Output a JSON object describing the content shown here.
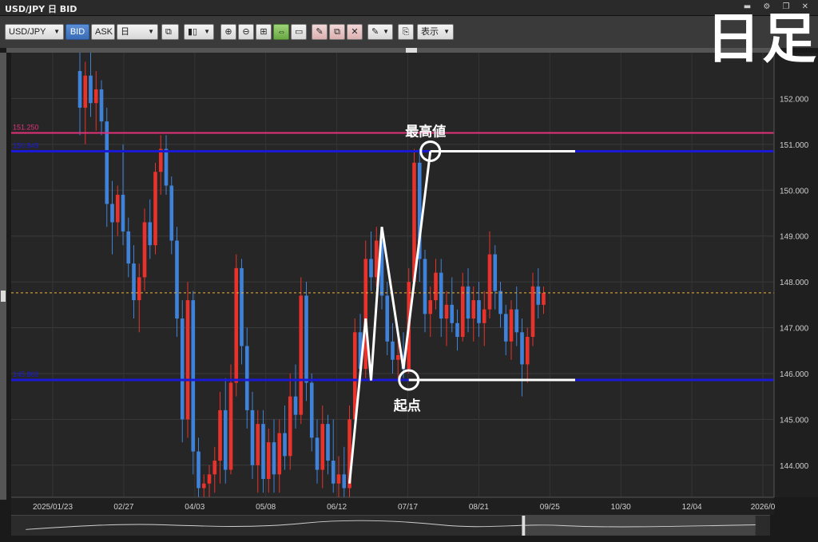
{
  "window": {
    "title": "USD/JPY 日 BID"
  },
  "page_heading": "日足",
  "toolbar": {
    "symbol": "USD/JPY",
    "bid_label": "BID",
    "ask_label": "ASK",
    "period": "日",
    "display_label": "表示"
  },
  "colors": {
    "background": "#262626",
    "up_candle": "#e8322b",
    "down_candle": "#3f82d9",
    "blue_line": "#1a1ad6",
    "pink_line": "#e0317b",
    "current_price": "#f0b23a"
  },
  "chart_data": {
    "type": "candlestick",
    "ylim": [
      143.3,
      153.0
    ],
    "y_ticks": [
      "152.000",
      "151.000",
      "150.000",
      "149.000",
      "148.000",
      "147.000",
      "146.000",
      "145.000",
      "144.000"
    ],
    "y_tick_values": [
      152,
      151,
      150,
      149,
      148,
      147,
      146,
      145,
      144
    ],
    "x_ticks": [
      "2025/01/23",
      "02/27",
      "04/03",
      "05/08",
      "06/12",
      "07/17",
      "08/21",
      "09/25",
      "10/30",
      "12/04",
      "2026/0"
    ],
    "horizontal_lines": [
      {
        "value": 151.25,
        "label": "151.250",
        "color": "pink"
      },
      {
        "value": 150.85,
        "label": "150.849",
        "color": "blue"
      },
      {
        "value": 145.86,
        "label": "145.860",
        "color": "blue"
      }
    ],
    "current_price": {
      "value": 147.761,
      "label": "147.761"
    },
    "annotations": [
      {
        "text": "最高値",
        "x_index": 65,
        "y": 150.85
      },
      {
        "text": "起点",
        "x_index": 61,
        "y": 145.86
      }
    ],
    "zigzag": [
      {
        "x_index": 50,
        "y": 143.6
      },
      {
        "x_index": 53,
        "y": 147.2
      },
      {
        "x_index": 54,
        "y": 145.85
      },
      {
        "x_index": 56,
        "y": 149.2
      },
      {
        "x_index": 60,
        "y": 146.1
      },
      {
        "x_index": 65,
        "y": 150.85
      }
    ],
    "candles": [
      [
        152.6,
        153.0,
        151.2,
        151.8
      ],
      [
        151.8,
        152.8,
        151.0,
        152.5
      ],
      [
        152.5,
        153.0,
        151.6,
        151.9
      ],
      [
        151.9,
        152.6,
        151.3,
        152.2
      ],
      [
        152.2,
        152.4,
        151.2,
        151.5
      ],
      [
        151.5,
        151.8,
        149.2,
        149.7
      ],
      [
        149.7,
        150.2,
        148.6,
        149.3
      ],
      [
        149.3,
        150.1,
        149.0,
        149.9
      ],
      [
        149.9,
        151.0,
        148.8,
        149.1
      ],
      [
        149.1,
        149.4,
        148.1,
        148.4
      ],
      [
        148.4,
        148.8,
        147.2,
        147.6
      ],
      [
        147.6,
        148.4,
        146.9,
        148.1
      ],
      [
        148.1,
        149.6,
        147.8,
        149.3
      ],
      [
        149.3,
        149.8,
        148.5,
        148.8
      ],
      [
        148.8,
        150.6,
        148.6,
        150.4
      ],
      [
        150.4,
        151.2,
        149.9,
        150.9
      ],
      [
        150.9,
        151.2,
        149.9,
        150.1
      ],
      [
        150.1,
        150.3,
        148.6,
        148.9
      ],
      [
        148.9,
        149.2,
        146.8,
        147.2
      ],
      [
        147.2,
        147.6,
        144.5,
        145.0
      ],
      [
        145.0,
        148.0,
        144.6,
        147.6
      ],
      [
        147.6,
        147.8,
        143.8,
        144.3
      ],
      [
        144.3,
        144.6,
        143.3,
        143.5
      ],
      [
        143.5,
        143.8,
        143.3,
        143.6
      ],
      [
        143.6,
        144.0,
        143.3,
        143.8
      ],
      [
        143.8,
        144.4,
        143.4,
        144.1
      ],
      [
        144.1,
        145.6,
        143.6,
        145.2
      ],
      [
        145.2,
        145.9,
        143.6,
        143.9
      ],
      [
        143.9,
        146.2,
        143.8,
        145.8
      ],
      [
        145.8,
        148.6,
        145.5,
        148.3
      ],
      [
        148.3,
        148.5,
        146.2,
        146.6
      ],
      [
        146.6,
        147.0,
        144.8,
        145.2
      ],
      [
        145.2,
        145.6,
        143.7,
        144.0
      ],
      [
        144.0,
        145.2,
        143.4,
        144.9
      ],
      [
        144.9,
        145.2,
        143.4,
        143.7
      ],
      [
        143.7,
        144.8,
        143.4,
        144.5
      ],
      [
        144.5,
        145.0,
        143.4,
        143.8
      ],
      [
        143.8,
        145.0,
        143.4,
        144.7
      ],
      [
        144.7,
        145.3,
        143.9,
        144.2
      ],
      [
        144.2,
        146.0,
        143.9,
        145.5
      ],
      [
        145.5,
        146.2,
        144.8,
        145.1
      ],
      [
        145.1,
        148.1,
        144.9,
        147.7
      ],
      [
        147.7,
        148.0,
        145.4,
        145.8
      ],
      [
        145.8,
        146.0,
        144.3,
        144.6
      ],
      [
        144.6,
        145.0,
        143.6,
        143.9
      ],
      [
        143.9,
        145.3,
        143.5,
        144.9
      ],
      [
        144.9,
        145.1,
        143.8,
        144.1
      ],
      [
        144.1,
        145.0,
        143.4,
        143.6
      ],
      [
        143.6,
        144.2,
        143.3,
        143.8
      ],
      [
        143.8,
        144.4,
        143.3,
        143.5
      ],
      [
        143.5,
        145.3,
        143.3,
        145.0
      ],
      [
        145.0,
        147.2,
        144.8,
        146.9
      ],
      [
        146.9,
        147.3,
        145.8,
        146.1
      ],
      [
        146.1,
        148.9,
        145.9,
        148.5
      ],
      [
        148.5,
        149.1,
        147.8,
        148.1
      ],
      [
        148.1,
        149.2,
        147.9,
        148.9
      ],
      [
        148.9,
        149.0,
        147.4,
        147.7
      ],
      [
        147.7,
        148.0,
        146.4,
        146.7
      ],
      [
        146.7,
        147.1,
        146.0,
        146.3
      ],
      [
        146.3,
        146.8,
        145.9,
        146.4
      ],
      [
        146.4,
        146.9,
        145.9,
        146.1
      ],
      [
        146.1,
        148.3,
        146.0,
        148.0
      ],
      [
        148.0,
        150.9,
        147.9,
        150.6
      ],
      [
        150.6,
        150.9,
        148.0,
        148.5
      ],
      [
        148.5,
        148.7,
        146.9,
        147.3
      ],
      [
        147.3,
        147.9,
        146.8,
        147.6
      ],
      [
        147.6,
        148.5,
        147.4,
        148.2
      ],
      [
        148.2,
        148.5,
        146.8,
        147.2
      ],
      [
        147.2,
        147.8,
        146.6,
        147.5
      ],
      [
        147.5,
        148.1,
        146.9,
        147.1
      ],
      [
        147.1,
        147.4,
        146.5,
        146.8
      ],
      [
        146.8,
        148.2,
        146.7,
        147.9
      ],
      [
        147.9,
        148.3,
        146.9,
        147.2
      ],
      [
        147.2,
        147.9,
        146.7,
        147.6
      ],
      [
        147.6,
        148.0,
        146.8,
        147.1
      ],
      [
        147.1,
        147.8,
        146.6,
        147.4
      ],
      [
        147.4,
        149.1,
        147.2,
        148.6
      ],
      [
        148.6,
        148.8,
        147.4,
        147.8
      ],
      [
        147.8,
        148.0,
        147.0,
        147.3
      ],
      [
        147.3,
        147.5,
        146.4,
        146.7
      ],
      [
        146.7,
        147.6,
        146.3,
        147.4
      ],
      [
        147.4,
        147.9,
        146.6,
        146.9
      ],
      [
        146.9,
        147.2,
        145.5,
        146.2
      ],
      [
        146.2,
        147.0,
        145.8,
        146.8
      ],
      [
        146.8,
        148.2,
        146.6,
        147.9
      ],
      [
        147.9,
        148.3,
        147.2,
        147.5
      ],
      [
        147.5,
        147.9,
        147.3,
        147.76
      ]
    ]
  }
}
